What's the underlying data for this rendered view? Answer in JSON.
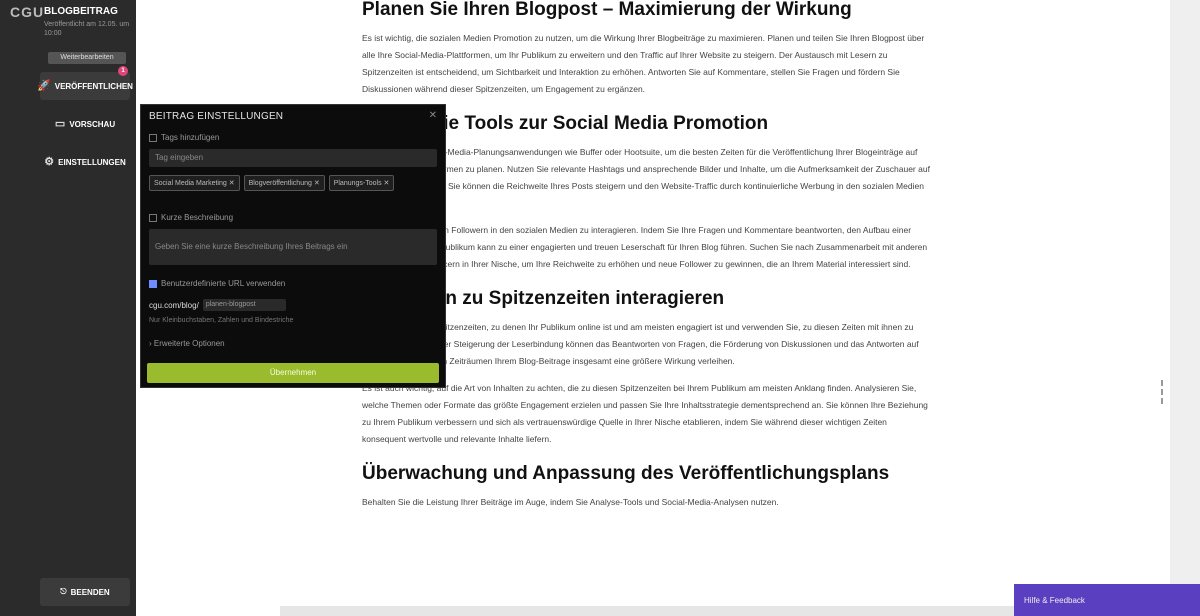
{
  "sidebar": {
    "logo_text": "CGU",
    "post_type": "BLOGBEITRAG",
    "status_lines": "Veröffentlicht am 12.05. um 10:00",
    "badge": "Weiterbearbeiten",
    "publish_label": "VERÖFFENTLICHEN",
    "publish_badge_count": "1",
    "preview_label": "VORSCHAU",
    "settings_label": "EINSTELLUNGEN",
    "close_label": "BEENDEN"
  },
  "article": {
    "sections": [
      {
        "heading": "Planen Sie Ihren Blogpost – Maximierung der Wirkung",
        "paragraphs": [
          "Es ist wichtig, die sozialen Medien Promotion zu nutzen, um die Wirkung Ihrer Blogbeiträge zu maximieren. Planen und teilen Sie Ihren Blogpost über alle Ihre Social-Media-Plattformen, um Ihr Publikum zu erweitern und den Traffic auf Ihrer Website zu steigern. Der Austausch mit Lesern zu Spitzenzeiten ist entscheidend, um Sichtbarkeit und Interaktion zu erhöhen. Antworten Sie auf Kommentare, stellen Sie Fragen und fördern Sie Diskussionen während dieser Spitzenzeiten, um Engagement zu ergänzen."
        ]
      },
      {
        "heading": "Nutzen Sie Tools zur Social Media Promotion",
        "paragraphs": [
          "Verwenden Sie Social-Media-Planungsanwendungen wie Buffer oder Hootsuite, um die besten Zeiten für die Veröffentlichung Ihrer Blogeinträge auf verschiedenen Plattformen zu planen. Nutzen Sie relevante Hashtags und ansprechende Bilder und Inhalte, um die Aufmerksamkeit der Zuschauer auf Ihr Material zu lenken. Sie können die Reichweite Ihres Posts steigern und den Website-Traffic durch kontinuierliche Werbung in den sozialen Medien erhöhen.",
          "Es ist wichtig, mit Ihren Followern in den sozialen Medien zu interagieren. Indem Sie Ihre Fragen und Kommentare beantworten, den Aufbau einer Beziehung zu Ihrem Publikum kann zu einer engagierten und treuen Leserschaft für Ihren Blog führen. Suchen Sie nach Zusammenarbeit mit anderen Bloggern oder Influencern in Ihrer Nische, um Ihre Reichweite zu erhöhen und neue Follower zu gewinnen, die an Ihrem Material interessiert sind."
        ]
      },
      {
        "heading": "Mit Lesern zu Spitzenzeiten interagieren",
        "paragraphs": [
          "Bestimmen Sie die Spitzenzeiten, zu denen Ihr Publikum online ist und am meisten engagiert ist und verwenden Sie, zu diesen Zeiten mit ihnen zu interagieren. Neben der Steigerung der Leserbindung können das Beantworten von Fragen, die Förderung von Diskussionen und das Antworten auf Kommentare in diesen Zeiträumen Ihrem Blog-Beitrage insgesamt eine größere Wirkung verleihen.",
          "Es ist auch wichtig, auf die Art von Inhalten zu achten, die zu diesen Spitzenzeiten bei Ihrem Publikum am meisten Anklang finden. Analysieren Sie, welche Themen oder Formate das größte Engagement erzielen und passen Sie Ihre Inhaltsstrategie dementsprechend an. Sie können Ihre Beziehung zu Ihrem Publikum verbessern und sich als vertrauenswürdige Quelle in Ihrer Nische etablieren, indem Sie während dieser wichtigen Zeiten konsequent wertvolle und relevante Inhalte liefern."
        ]
      },
      {
        "heading": "Überwachung und Anpassung des Veröffentlichungsplans",
        "paragraphs": [
          "Behalten Sie die Leistung Ihrer Beiträge im Auge, indem Sie Analyse-Tools und Social-Media-Analysen nutzen."
        ]
      }
    ]
  },
  "panel": {
    "title": "BEITRAG EINSTELLUNGEN",
    "close_icon": "close-icon",
    "check_tags_label": "Tags hinzufügen",
    "tags_placeholder": "Tag eingeben",
    "chips": [
      "Social Media Marketing ✕",
      "Blogveröffentlichung ✕",
      "Planungs-Tools ✕"
    ],
    "check_summary_label": "Kurze Beschreibung",
    "summary_placeholder": "Geben Sie eine kurze Beschreibung Ihres Beitrags ein",
    "check_url_label": "Benutzerdefinierte URL verwenden",
    "url_prefix": "cgu.com/blog/",
    "url_slug": "planen-blogpost",
    "url_note": "Nur Kleinbuchstaben, Zahlen und Bindestriche",
    "advanced_label": "Erweiterte Optionen",
    "apply_label": "Übernehmen"
  },
  "bottom_cta": {
    "label": "Hilfe & Feedback"
  },
  "colors": {
    "sidebar_bg": "#2b2b2b",
    "panel_bg": "#0c0c0c",
    "apply_green": "#9bbb2e",
    "cta_purple": "#5a3fc0",
    "notif_pink": "#e0457b"
  }
}
